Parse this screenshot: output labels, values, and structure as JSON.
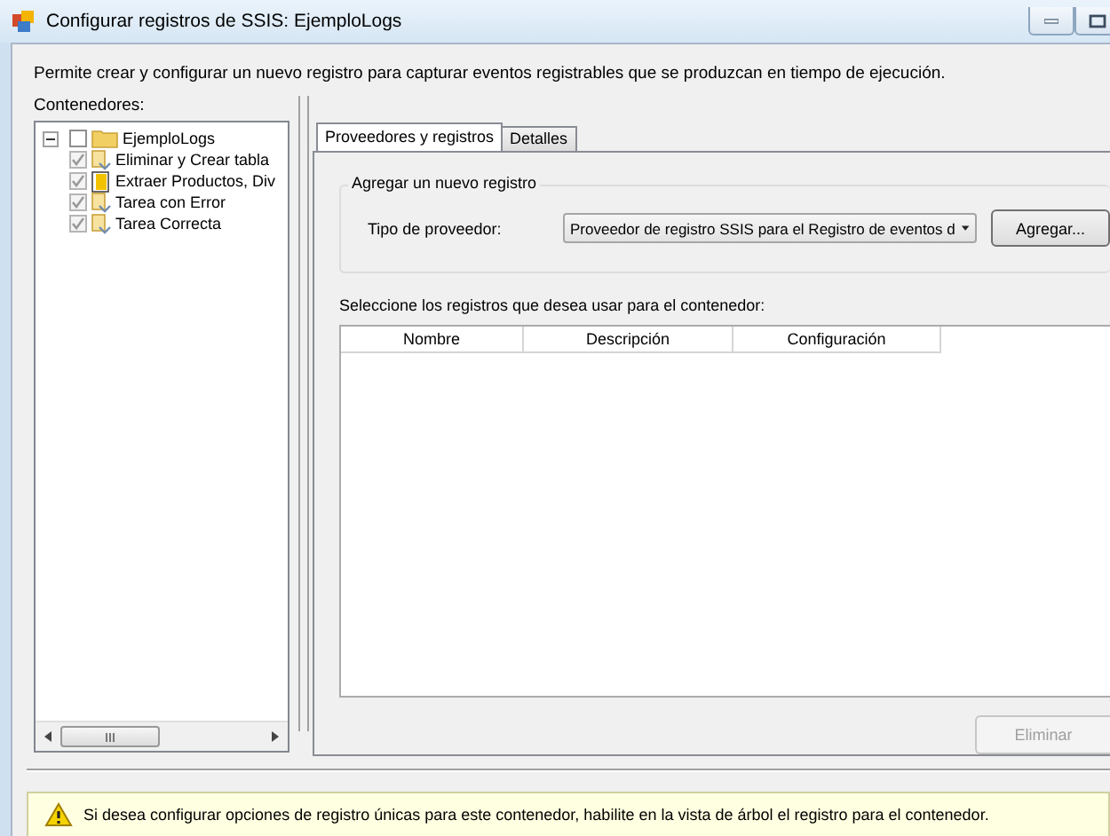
{
  "window": {
    "title": "Configurar registros de SSIS: EjemploLogs"
  },
  "description": "Permite crear y configurar un nuevo registro para capturar eventos registrables que se produzcan en tiempo de ejecución.",
  "containers": {
    "label": "Contenedores:",
    "tree": [
      {
        "label": "EjemploLogs",
        "kind": "folder",
        "checked": false,
        "disabled": false,
        "expanded": true,
        "children": [
          {
            "label": "Eliminar y Crear tabla",
            "kind": "task",
            "checked": true,
            "disabled": true
          },
          {
            "label": "Extraer Productos, Div",
            "kind": "dataflow",
            "checked": true,
            "disabled": true
          },
          {
            "label": "Tarea con Error",
            "kind": "task",
            "checked": true,
            "disabled": true
          },
          {
            "label": "Tarea Correcta",
            "kind": "task",
            "checked": true,
            "disabled": true
          }
        ]
      }
    ]
  },
  "tabs": [
    {
      "label": "Proveedores y registros",
      "selected": true
    },
    {
      "label": "Detalles",
      "selected": false
    }
  ],
  "add_log": {
    "title": "Agregar un nuevo registro",
    "provider_label": "Tipo de proveedor:",
    "provider_value": "Proveedor de registro SSIS para el Registro de eventos d",
    "add_button": "Agregar..."
  },
  "logs": {
    "label": "Seleccione los registros que desea usar para el contenedor:",
    "columns": [
      "Nombre",
      "Descripción",
      "Configuración"
    ]
  },
  "delete_button": {
    "label": "Eliminar",
    "disabled": true
  },
  "warning": "Si desea configurar opciones de registro únicas para este contenedor, habilite en la vista de árbol el registro para el contenedor."
}
